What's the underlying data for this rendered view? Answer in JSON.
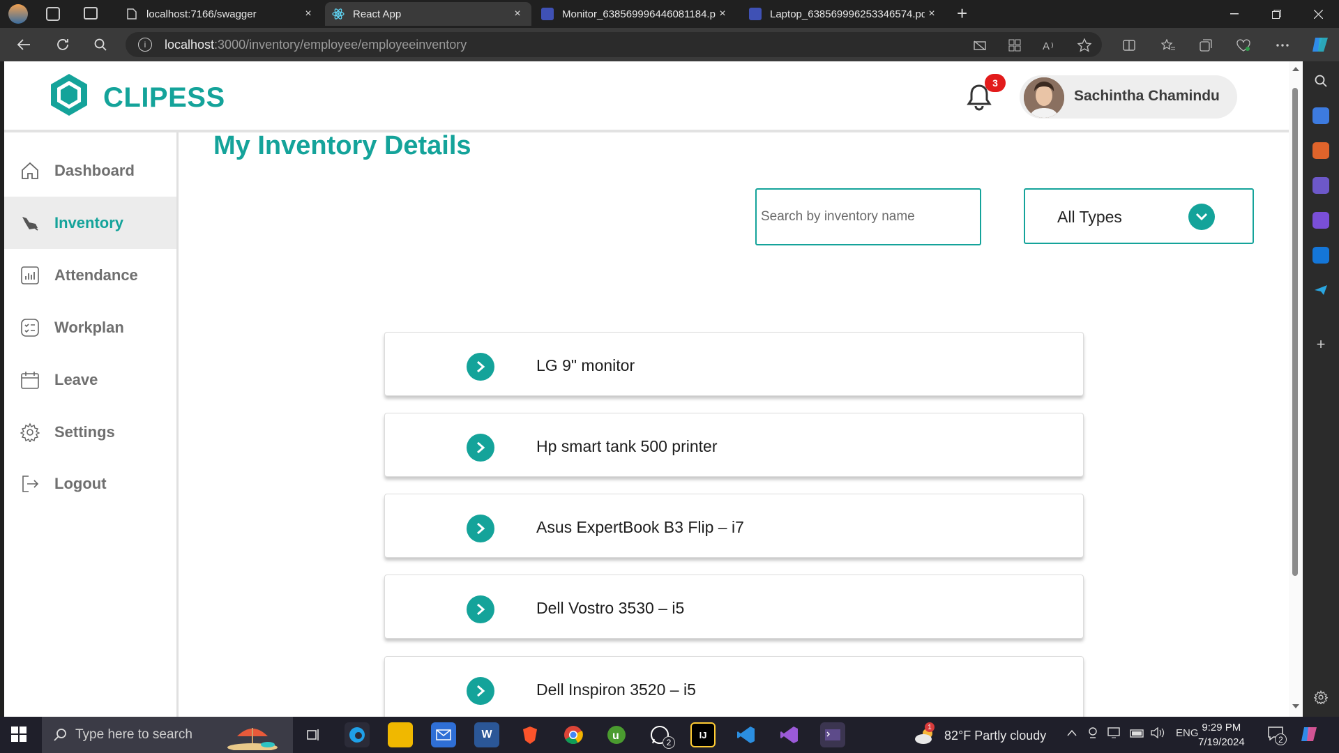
{
  "browser": {
    "tabs": [
      {
        "label": "localhost:7166/swagger",
        "icon": "page-icon"
      },
      {
        "label": "React App",
        "icon": "react-icon"
      },
      {
        "label": "Monitor_638569996446081184.p",
        "icon": "pdf-icon"
      },
      {
        "label": "Laptop_638569996253346574.pd",
        "icon": "pdf-icon"
      }
    ],
    "close_glyph": "×",
    "new_tab_glyph": "+",
    "url_host": "localhost",
    "url_rest": ":3000/inventory/employee/employeeinventory"
  },
  "app": {
    "brand": "CLIPESS",
    "brand_color": "#14a39a",
    "notifications_count": "3",
    "user_name": "Sachintha Chamindu"
  },
  "sidebar": {
    "items": [
      {
        "label": "Dashboard",
        "icon": "home-icon"
      },
      {
        "label": "Inventory",
        "icon": "inventory-icon",
        "active": true
      },
      {
        "label": "Attendance",
        "icon": "chart-icon"
      },
      {
        "label": "Workplan",
        "icon": "checklist-icon"
      },
      {
        "label": "Leave",
        "icon": "calendar-icon"
      },
      {
        "label": "Settings",
        "icon": "gear-icon"
      },
      {
        "label": "Logout",
        "icon": "logout-icon"
      }
    ]
  },
  "main": {
    "title": "My Inventory Details",
    "search_placeholder": "Search by inventory name",
    "type_filter": "All Types",
    "items": [
      "LG 9\" monitor",
      "Hp smart tank 500 printer",
      "Asus ExpertBook B3 Flip – i7",
      "Dell Vostro 3530 – i5",
      "Dell Inspiron 3520 – i5"
    ]
  },
  "taskbar": {
    "search_placeholder": "Type here to search",
    "whatsapp_badge": "2",
    "weather": "82°F  Partly cloudy",
    "weather_badge": "1",
    "language": "ENG",
    "time": "9:29 PM",
    "date": "7/19/2024",
    "notif_count": "2"
  }
}
